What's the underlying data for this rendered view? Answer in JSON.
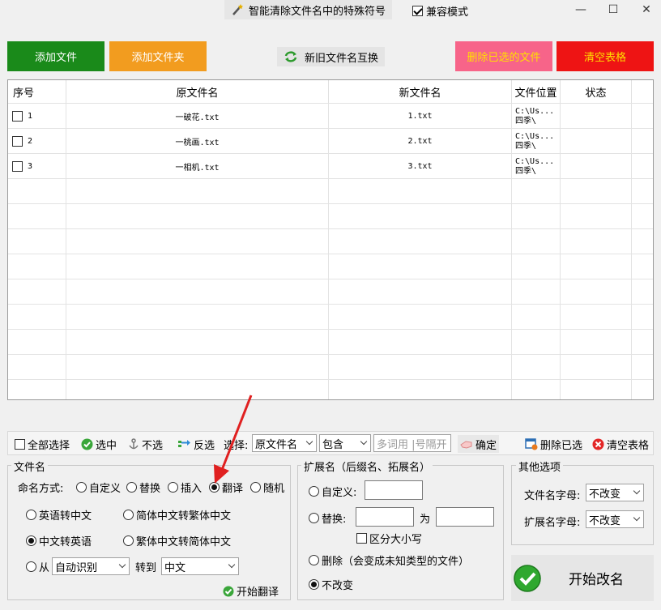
{
  "title": "智能清除文件名中的特殊符号",
  "compat_label": "兼容模式",
  "window": {
    "minimize": "—",
    "maximize": "☐",
    "close": "✕"
  },
  "top_buttons": {
    "add_file": "添加文件",
    "add_folder": "添加文件夹",
    "swap": "新旧文件名互换",
    "delete_selected": "删除已选的文件",
    "clear_table": "清空表格"
  },
  "colors": {
    "green": "#1a8a1a",
    "orange": "#f29c1f",
    "pink": "#f76489",
    "red": "#ee1414"
  },
  "table": {
    "headers": [
      "序号",
      "原文件名",
      "新文件名",
      "文件位置",
      "状态"
    ],
    "rows": [
      {
        "no": "1",
        "orig": "一破花.txt",
        "new": "1.txt",
        "loc1": "C:\\Us...",
        "loc2": "四季\\",
        "status": ""
      },
      {
        "no": "2",
        "orig": "一桃画.txt",
        "new": "2.txt",
        "loc1": "C:\\Us...",
        "loc2": "四季\\",
        "status": ""
      },
      {
        "no": "3",
        "orig": "一相机.txt",
        "new": "3.txt",
        "loc1": "C:\\Us...",
        "loc2": "四季\\",
        "status": ""
      }
    ]
  },
  "toolbar": {
    "select_all": "全部选择",
    "select": "选中",
    "deselect": "不选",
    "invert": "反选",
    "choose_label": "选择:",
    "field_value": "原文件名",
    "match_value": "包含",
    "keyword_placeholder": "多词用 |号隔开",
    "confirm": "确定",
    "delete_selected": "删除已选",
    "clear_table": "清空表格"
  },
  "filename_group": {
    "title": "文件名",
    "mode_label": "命名方式:",
    "modes": [
      "自定义",
      "替换",
      "插入",
      "翻译",
      "随机"
    ],
    "selected_mode": "翻译",
    "opt_en2zh": "英语转中文",
    "opt_s2t": "简体中文转繁体中文",
    "opt_zh2en": "中文转英语",
    "opt_t2s": "繁体中文转简体中文",
    "from_label": "从",
    "from_value": "自动识别",
    "to_label": "转到",
    "to_value": "中文",
    "start_translate": "开始翻译"
  },
  "ext_group": {
    "title": "扩展名（后缀名、拓展名）",
    "custom": "自定义:",
    "replace": "替换:",
    "as": "为",
    "case": "区分大小写",
    "delete": "删除（会变成未知类型的文件）",
    "unchanged": "不改变"
  },
  "other_group": {
    "title": "其他选项",
    "name_case_label": "文件名字母:",
    "name_case_value": "不改变",
    "ext_case_label": "扩展名字母:",
    "ext_case_value": "不改变"
  },
  "start_rename": "开始改名"
}
